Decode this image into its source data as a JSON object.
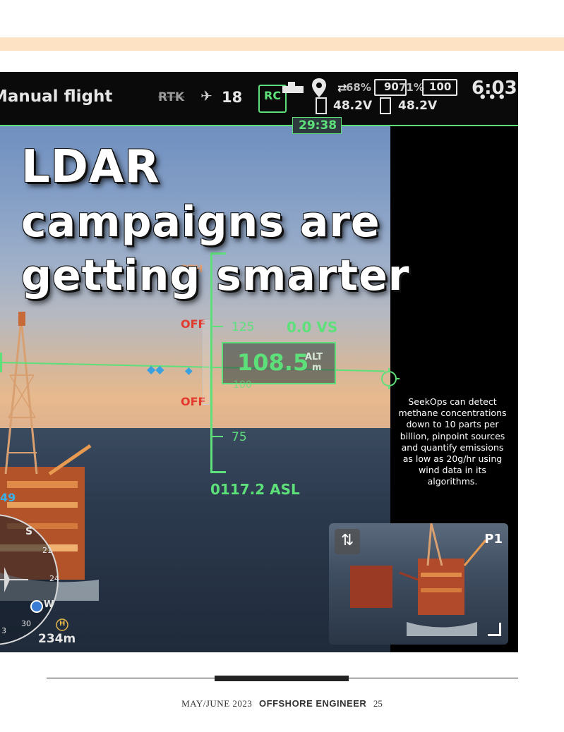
{
  "hud": {
    "mode": "Manual flight",
    "rtk": "RTK",
    "satellites": "18",
    "rc": "RC",
    "signal": "68%",
    "battery1_voltage": "48.2V",
    "battery2_pct": "90",
    "battery2_signal": "71%",
    "battery2_voltage": "48.2V",
    "battery3_pct": "100",
    "clock": "6:03",
    "timer": "29:38",
    "speed_ref": "125",
    "vs": "0.0 VS",
    "alt_value": "108.5",
    "alt_label": "ALT",
    "alt_unit": "m",
    "alt_hidden": "100",
    "tick_75": "75",
    "off_top": "OFF",
    "off_bottom": "OFF",
    "asl": "0117.2 ASL",
    "rth": "RTH",
    "heading_49": "49",
    "compass_s": "S",
    "compass_21": "21",
    "compass_24": "24",
    "compass_w": "W",
    "compass_30": "30",
    "compass_3": "3",
    "home_icon_label": "H",
    "distance": "234m",
    "pip_label": "P1"
  },
  "headline": {
    "line1": "LDAR",
    "line2": "campaigns are",
    "line3": "getting smarter"
  },
  "caption": "SeekOps can detect methane concentrations down to 10 parts per billion, pinpoint sources and quantify emissions as low as 20g/hr using wind data in its algorithms.",
  "footer": {
    "date": "MAY/JUNE 2023",
    "publication": "OFFSHORE ENGINEER",
    "page": "25"
  }
}
